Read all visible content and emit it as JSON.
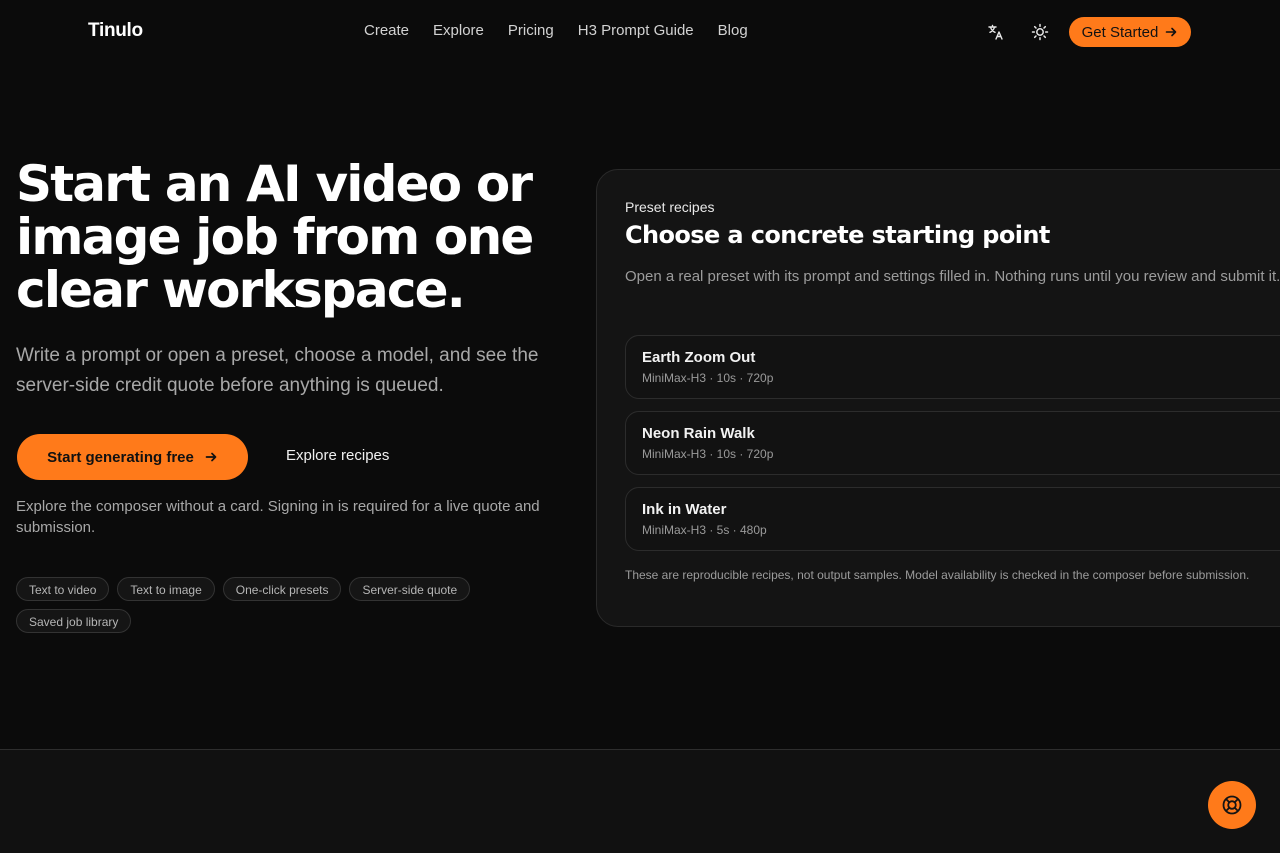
{
  "nav": {
    "logo": "Tinulo",
    "links": [
      "Create",
      "Explore",
      "Pricing",
      "H3 Prompt Guide",
      "Blog"
    ],
    "language_icon": "translate-icon",
    "theme_icon": "sun-icon",
    "get_started": "Get Started"
  },
  "hero": {
    "title": "Start an AI video or image job from one clear workspace.",
    "subtitle": "Write a prompt or open a preset, choose a model, and see the server-side credit quote before anything is queued.",
    "cta_primary": "Start generating free",
    "cta_secondary": "Explore recipes",
    "note": "Explore the composer without a card. Signing in is required for a live quote and submission.",
    "tags": [
      "Text to video",
      "Text to image",
      "One-click presets",
      "Server-side quote",
      "Saved job library"
    ]
  },
  "card": {
    "eyebrow": "Preset recipes",
    "title": "Choose a concrete starting point",
    "description": "Open a real preset with its prompt and settings filled in. Nothing runs until you review and submit it.",
    "recipes": [
      {
        "title": "Earth Zoom Out",
        "meta": "MiniMax-H3 · 10s · 720p"
      },
      {
        "title": "Neon Rain Walk",
        "meta": "MiniMax-H3 · 10s · 720p"
      },
      {
        "title": "Ink in Water",
        "meta": "MiniMax-H3 · 5s · 480p"
      }
    ],
    "footnote": "These are reproducible recipes, not output samples. Model availability is checked in the composer before submission."
  },
  "help_icon": "lifebuoy-icon",
  "colors": {
    "accent": "#ff7a1a",
    "background": "#0b0b0b",
    "card": "#141414"
  }
}
